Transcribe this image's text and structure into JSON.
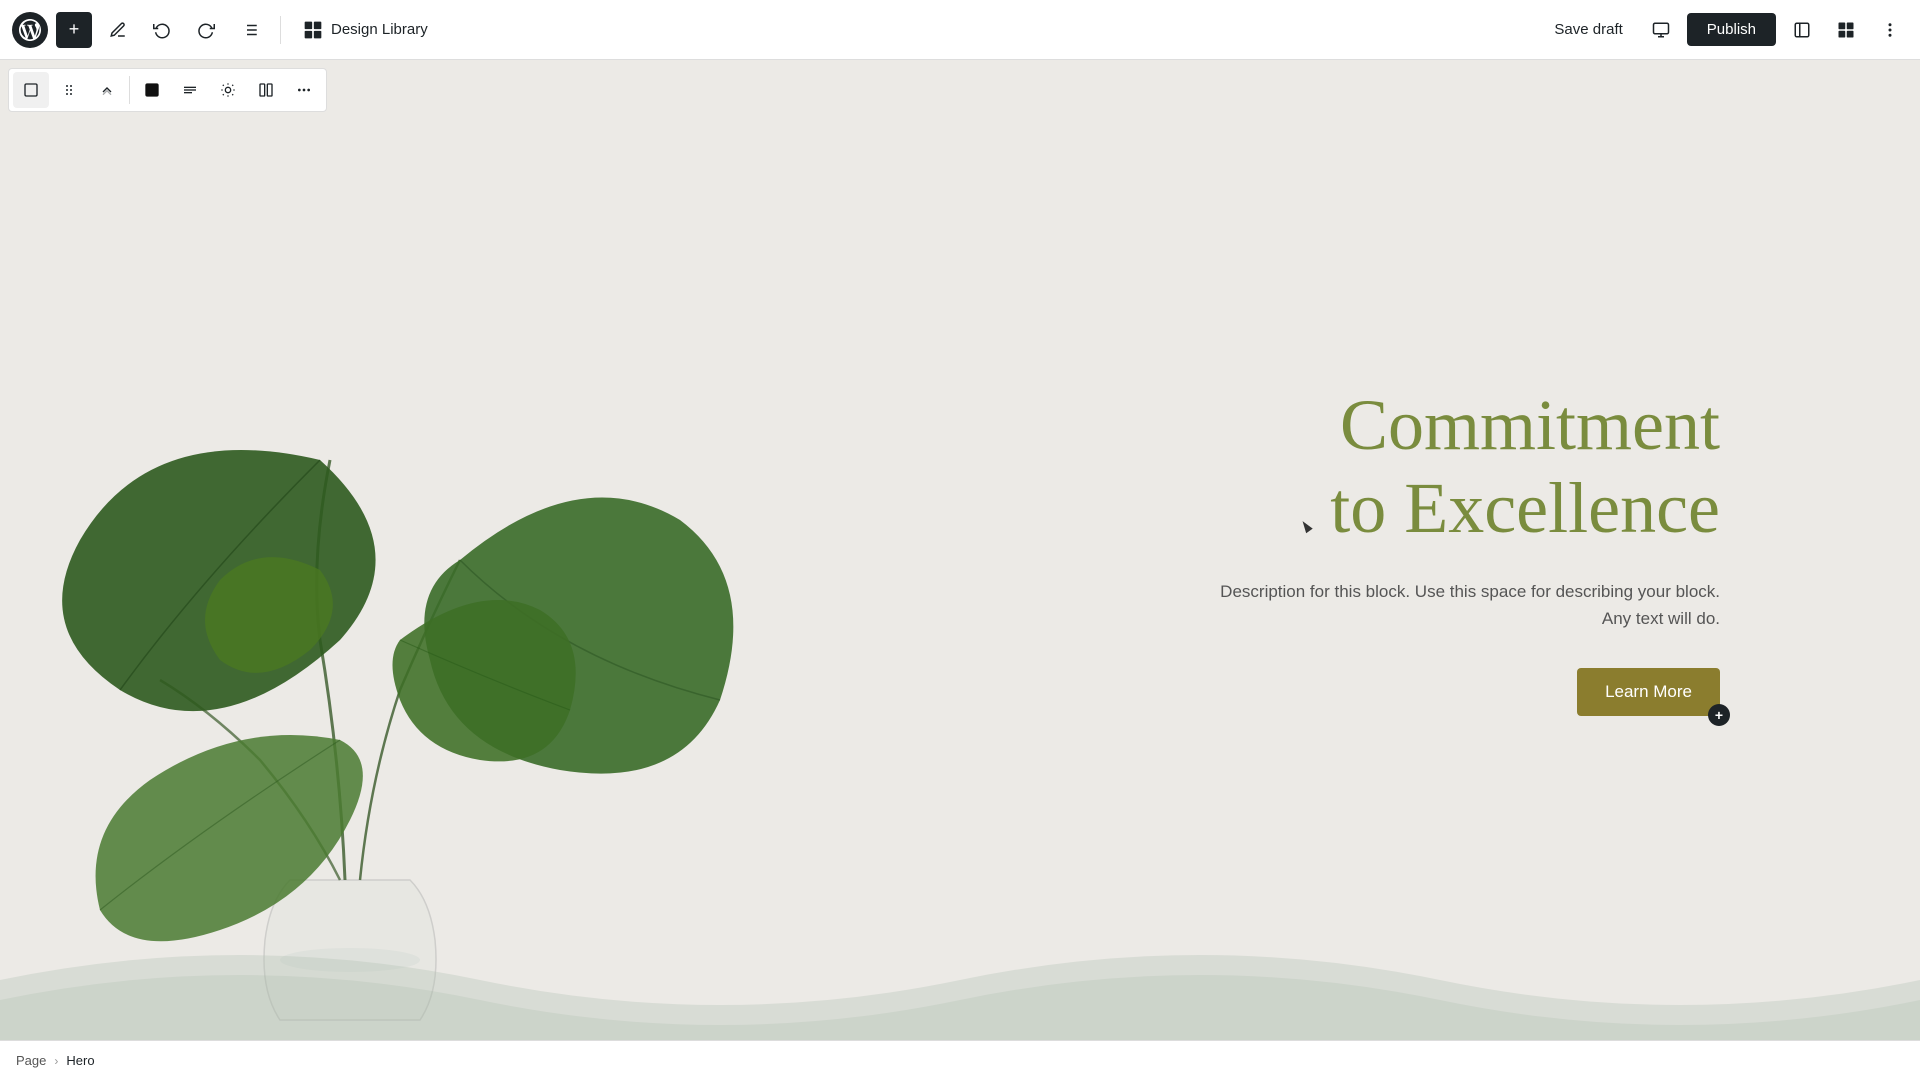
{
  "topbar": {
    "add_btn_label": "+",
    "design_library_label": "Design Library",
    "save_draft_label": "Save draft",
    "publish_label": "Publish"
  },
  "block_toolbar": {
    "buttons": [
      "block-select",
      "drag",
      "arrows",
      "color",
      "align",
      "animation",
      "columns",
      "more"
    ]
  },
  "hero": {
    "title_line1": "Commitment",
    "title_line2": "to Excellence",
    "description": "Description for this block. Use this space for describing your block. Any text will do.",
    "cta_label": "Learn More",
    "cta_plus": "+"
  },
  "status_bar": {
    "page_label": "Page",
    "separator": "›",
    "hero_label": "Hero"
  },
  "colors": {
    "title": "#7a8c3e",
    "cta_bg": "#8b7d2e",
    "cta_text": "#ffffff",
    "badge_bg": "#1d2327",
    "publish_bg": "#1d2327"
  }
}
